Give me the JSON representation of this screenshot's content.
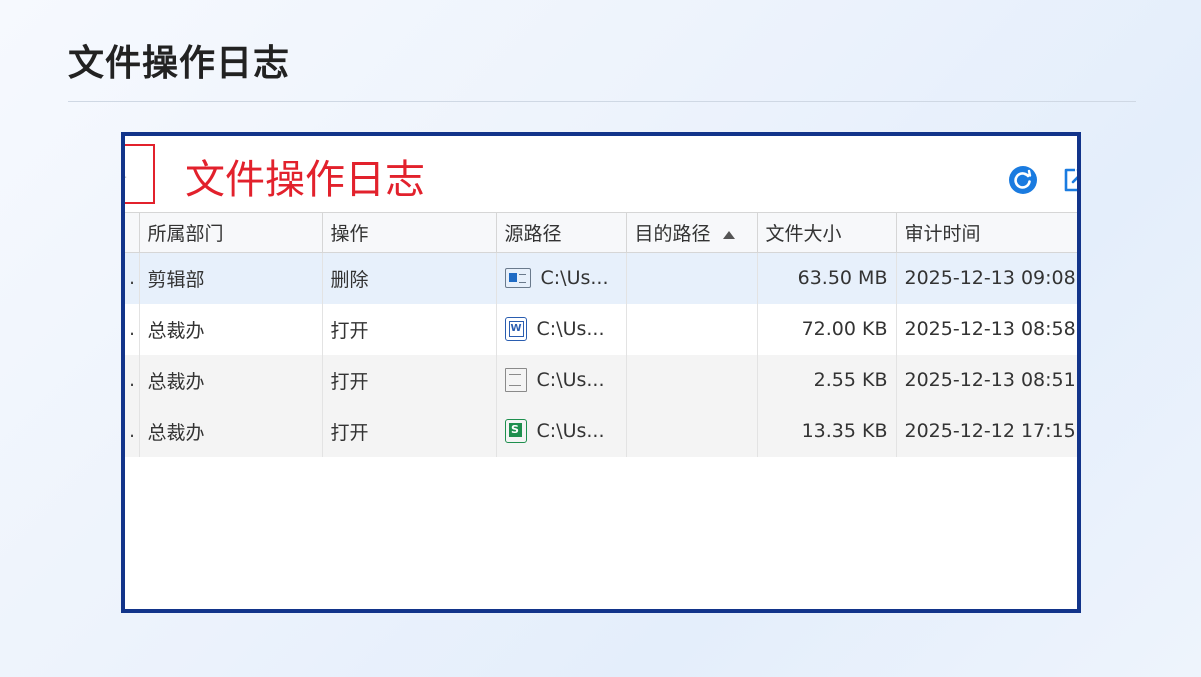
{
  "slide": {
    "title": "文件操作日志"
  },
  "panel": {
    "title": "文件操作日志",
    "icons": [
      "refresh-icon",
      "export-icon"
    ]
  },
  "table": {
    "columns": [
      "",
      "所属部门",
      "操作",
      "源路径",
      "目的路径",
      "文件大小",
      "审计时间"
    ],
    "sorted_column": "目的路径",
    "sort_direction": "asc",
    "rows": [
      {
        "lead": ".",
        "dept": "剪辑部",
        "action": "删除",
        "icon": "video-file-icon",
        "src": "C:\\Us...",
        "dst": "",
        "size": "63.50 MB",
        "time": "2025-12-13 09:08"
      },
      {
        "lead": ".",
        "dept": "总裁办",
        "action": "打开",
        "icon": "word-file-icon",
        "src": "C:\\Us...",
        "dst": "",
        "size": "72.00 KB",
        "time": "2025-12-13 08:58"
      },
      {
        "lead": ".",
        "dept": "总裁办",
        "action": "打开",
        "icon": "text-file-icon",
        "src": "C:\\Us...",
        "dst": "",
        "size": "2.55 KB",
        "time": "2025-12-13 08:51"
      },
      {
        "lead": ".",
        "dept": "总裁办",
        "action": "打开",
        "icon": "spreadsheet-file-icon",
        "src": "C:\\Us...",
        "dst": "",
        "size": "13.35 KB",
        "time": "2025-12-12 17:15"
      }
    ]
  },
  "colors": {
    "frame_border": "#12348a",
    "panel_title": "#e2212c",
    "selected_row": "#e7f0fb",
    "refresh_icon": "#1a7be0"
  }
}
